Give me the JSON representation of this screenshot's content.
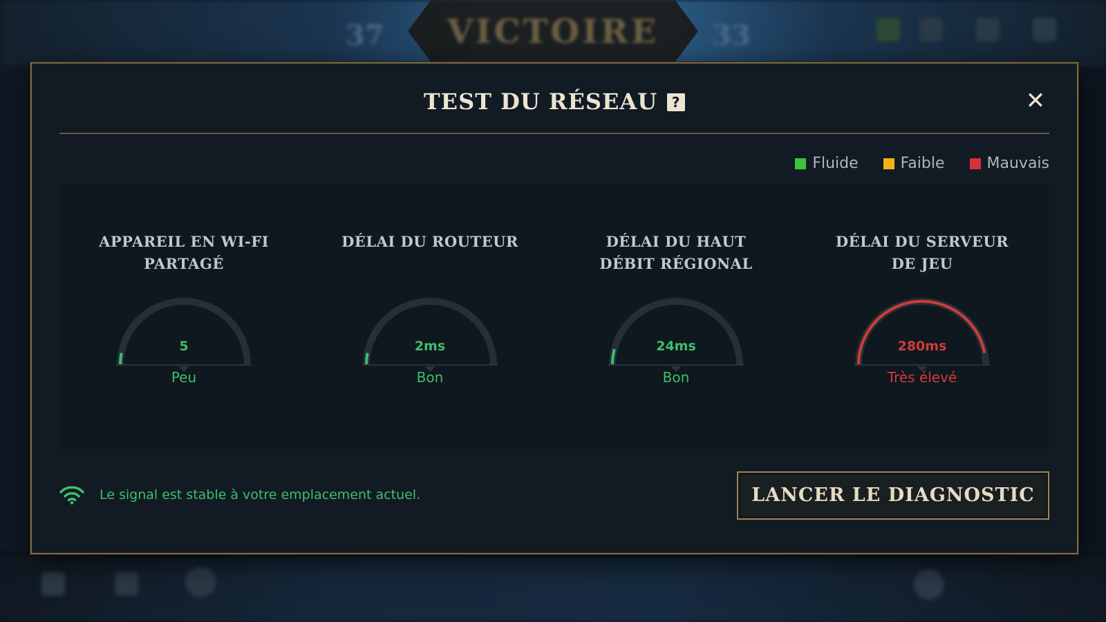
{
  "background": {
    "banner_text": "VICTOIRE",
    "score_left": "37",
    "score_right": "33"
  },
  "modal": {
    "title": "TEST DU RÉSEAU",
    "help_label": "?",
    "close_label": "✕"
  },
  "legend": [
    {
      "label": "Fluide",
      "color": "#3ec23a"
    },
    {
      "label": "Faible",
      "color": "#f2b318"
    },
    {
      "label": "Mauvais",
      "color": "#d8303a"
    }
  ],
  "metrics": [
    {
      "title": "APPAREIL EN WI-FI PARTAGÉ",
      "value": "5",
      "status": "Peu",
      "level": 0.06,
      "color": "#3fbf6a"
    },
    {
      "title": "DÉLAI DU ROUTEUR",
      "value": "2ms",
      "status": "Bon",
      "level": 0.06,
      "color": "#3fbf6a"
    },
    {
      "title": "DÉLAI DU HAUT DÉBIT RÉGIONAL",
      "value": "24ms",
      "status": "Bon",
      "level": 0.08,
      "color": "#3fbf6a"
    },
    {
      "title": "DÉLAI DU SERVEUR DE JEU",
      "value": "280ms",
      "status": "Très élevé",
      "level": 0.94,
      "color": "#d33a3a"
    }
  ],
  "footer": {
    "status_text": "Le signal est stable à votre emplacement actuel.",
    "status_color": "#3fbf6a",
    "diagnostic_label": "LANCER LE DIAGNOSTIC"
  }
}
